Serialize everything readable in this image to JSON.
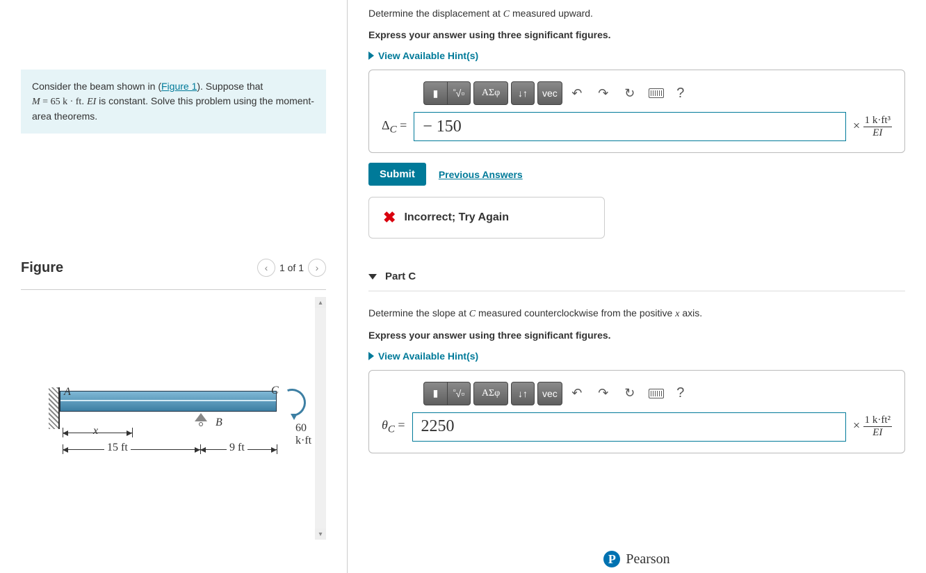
{
  "problem": {
    "text_prefix": "Consider the beam shown in (",
    "figure_link": "Figure 1",
    "text_mid": "). Suppose that ",
    "moment_var": "M",
    "moment_val": " = 65 k · ft",
    "text_ei": ". ",
    "ei_var": "EI",
    "text_suffix": " is constant. Solve this problem using the moment-area theorems."
  },
  "figure": {
    "title": "Figure",
    "pager": "1 of 1",
    "labels": {
      "A": "A",
      "B": "B",
      "C": "C",
      "x": "x",
      "span_ab": "15 ft",
      "span_bc": "9 ft",
      "moment": "60 k·ft"
    }
  },
  "partB": {
    "question_prefix": "Determine the displacement at ",
    "question_var": "C",
    "question_suffix": " measured upward.",
    "instruction": "Express your answer using three significant figures.",
    "hint_label": "View Available Hint(s)",
    "toolbar": {
      "greek": "ΑΣφ",
      "vec": "vec",
      "help": "?"
    },
    "answer_var": "Δ",
    "answer_sub": "C",
    "answer_eq": " = ",
    "answer_value": "− 150",
    "unit_times": "×",
    "unit_num": "1 k·ft³",
    "unit_den": "EI",
    "submit": "Submit",
    "prev": "Previous Answers",
    "feedback": "Incorrect; Try Again"
  },
  "partC": {
    "header": "Part C",
    "question_prefix": "Determine the slope at ",
    "question_var": "C",
    "question_mid": " measured counterclockwise from the positive ",
    "question_var2": "x",
    "question_suffix": " axis.",
    "instruction": "Express your answer using three significant figures.",
    "hint_label": "View Available Hint(s)",
    "toolbar": {
      "greek": "ΑΣφ",
      "vec": "vec",
      "help": "?"
    },
    "answer_var": "θ",
    "answer_sub": "C",
    "answer_eq": " = ",
    "answer_value": "2250",
    "unit_times": "×",
    "unit_num": "1 k·ft²",
    "unit_den": "EI"
  },
  "footer": {
    "brand": "Pearson",
    "logo": "P"
  }
}
